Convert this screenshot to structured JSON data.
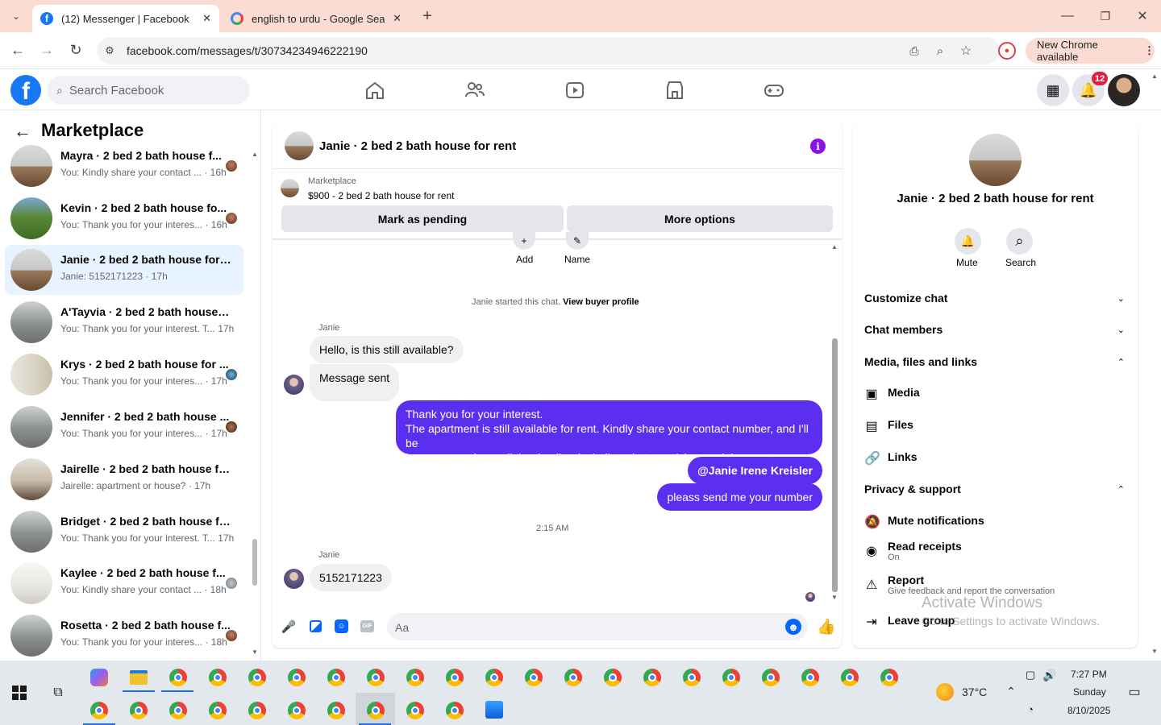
{
  "browser": {
    "tabs": [
      {
        "title": "(12) Messenger | Facebook"
      },
      {
        "title": "english to urdu - Google Search"
      }
    ],
    "url": "facebook.com/messages/t/30734234946222190",
    "update_label": "New Chrome available"
  },
  "fb": {
    "search_placeholder": "Search Facebook",
    "notif_count": "12"
  },
  "left": {
    "title": "Marketplace",
    "conversations": [
      {
        "title": "Mayra · 2 bed 2 bath house f...",
        "preview": "You: Kindly share your contact ... · 16h"
      },
      {
        "title": "Kevin · 2 bed 2 bath house fo...",
        "preview": "You: Thank you for your interes... · 16h"
      },
      {
        "title": "Janie · 2 bed 2 bath house for re...",
        "preview": "Janie: 5152171223 · 17h"
      },
      {
        "title": "A'Tayvia · 2 bed 2 bath house fo...",
        "preview": "You: Thank you for your interest. T... 17h"
      },
      {
        "title": "Krys · 2 bed 2 bath house for ...",
        "preview": "You: Thank you for your interes... · 17h"
      },
      {
        "title": "Jennifer · 2 bed 2 bath house ...",
        "preview": "You: Thank you for your interes... · 17h"
      },
      {
        "title": "Jairelle · 2 bed 2 bath house for ...",
        "preview": "Jairelle: apartment or house? · 17h"
      },
      {
        "title": "Bridget · 2 bed 2 bath house for...",
        "preview": "You: Thank you for your interest. T... 17h"
      },
      {
        "title": "Kaylee · 2 bed 2 bath house f...",
        "preview": "You: Kindly share your contact ... · 18h"
      },
      {
        "title": "Rosetta · 2 bed 2 bath house f...",
        "preview": "You: Thank you for your interes... · 18h"
      }
    ]
  },
  "chat": {
    "title": "Janie · 2 bed 2 bath house for rent",
    "listing_source": "Marketplace",
    "listing_line": "$900 - 2 bed 2 bath house for rent",
    "mark_pending": "Mark as pending",
    "more_options": "More options",
    "add_label": "Add",
    "name_label": "Name",
    "started_text": "Janie started this chat.",
    "view_profile": "View buyer profile",
    "sender1": "Janie",
    "msg1": "Hello, is this still available?",
    "msg2": "Message sent",
    "out1_line1": "Thank you for your interest.",
    "out1_line2": "The apartment is still available for rent. Kindly share your contact number, and I'll be",
    "out1_line3": "happy to send you all the details—including photos, pricing, and the exact location.",
    "out2": "@Janie Irene Kreisler",
    "out3": "pleass send me your number",
    "time": "2:15 AM",
    "sender2": "Janie",
    "msg3": "5152171223",
    "composer_placeholder": "Aa"
  },
  "right": {
    "title": "Janie · 2 bed 2 bath house for rent",
    "mute": "Mute",
    "search": "Search",
    "sections": {
      "customize": "Customize chat",
      "members": "Chat members",
      "media": "Media, files and links",
      "privacy": "Privacy & support"
    },
    "items": {
      "media": "Media",
      "files": "Files",
      "links": "Links",
      "mute_notif": "Mute notifications",
      "read_receipts": "Read receipts",
      "read_on": "On",
      "report": "Report",
      "report_sub": "Give feedback and report the conversation",
      "leave": "Leave group"
    }
  },
  "watermark": {
    "line1": "Activate Windows",
    "line2": "Go to Settings to activate Windows."
  },
  "taskbar": {
    "temp": "37°C",
    "time": "7:27 PM",
    "day": "Sunday",
    "date": "8/10/2025"
  }
}
